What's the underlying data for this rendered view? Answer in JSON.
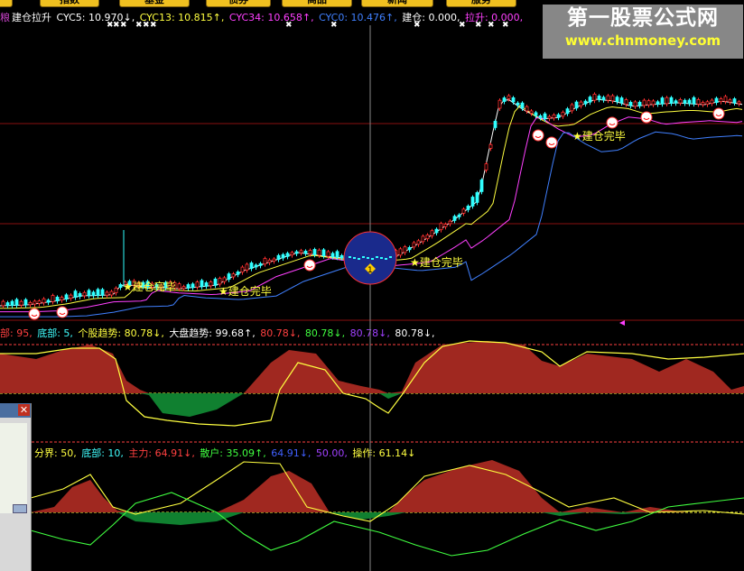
{
  "tabs": [
    "指数",
    "基金",
    "债券",
    "商品",
    "新闻",
    "服务"
  ],
  "main_legend": {
    "partial_prefix": "粮",
    "title": "建仓拉升",
    "items": [
      {
        "label": "CYC5",
        "value": "10.970",
        "arrow": "↓",
        "color": "#ffffff"
      },
      {
        "label": "CYC13",
        "value": "10.815",
        "arrow": "↑",
        "color": "#ffff40"
      },
      {
        "label": "CYC34",
        "value": "10.658",
        "arrow": "↑",
        "color": "#ff40ff"
      },
      {
        "label": "CYC0",
        "value": "10.476",
        "arrow": "↑",
        "color": "#4080ff"
      },
      {
        "label": "建仓",
        "value": "0.000",
        "arrow": ",",
        "color": "#ffffff"
      },
      {
        "label": "拉升",
        "value": "0.000",
        "arrow": ",",
        "color": "#ff40ff"
      }
    ]
  },
  "annotations": [
    "建仓完毕",
    "建仓完毕",
    "建仓完毕",
    "建仓完毕",
    "建仓完毕"
  ],
  "marker_value": "1",
  "trend_legend": {
    "items": [
      {
        "text": "部: 95,",
        "color": "#ff4040"
      },
      {
        "text": "底部: 5,",
        "color": "#40ffff"
      },
      {
        "text": "个股趋势: 80.78↓,",
        "color": "#ffff40"
      },
      {
        "text": "大盘趋势: 99.68↑,",
        "color": "#ffffff"
      },
      {
        "text": "80.78↓,",
        "color": "#ff4040"
      },
      {
        "text": "80.78↓,",
        "color": "#40ff40"
      },
      {
        "text": "80.78↓,",
        "color": "#a040ff"
      },
      {
        "text": "80.78↓,",
        "color": "#ffffff"
      }
    ]
  },
  "force_legend": {
    "items": [
      {
        "text": "分界: 50,",
        "color": "#ffff40"
      },
      {
        "text": "底部: 10,",
        "color": "#40ffff"
      },
      {
        "text": "主力: 64.91↓,",
        "color": "#ff4040"
      },
      {
        "text": "散户: 35.09↑,",
        "color": "#40ff40"
      },
      {
        "text": "64.91↓,",
        "color": "#4060ff"
      },
      {
        "text": "50.00,",
        "color": "#a040ff"
      },
      {
        "text": "操作: 61.14↓",
        "color": "#ffff40"
      }
    ]
  },
  "watermark": {
    "title": "第一股票公式网",
    "url": "www.chnmoney.com"
  },
  "colors": {
    "up": "#ff3030",
    "down": "#30ffff",
    "ma5": "#ffffff",
    "ma13": "#ffff40",
    "ma34": "#ff40ff",
    "ma0": "#4080ff"
  }
}
